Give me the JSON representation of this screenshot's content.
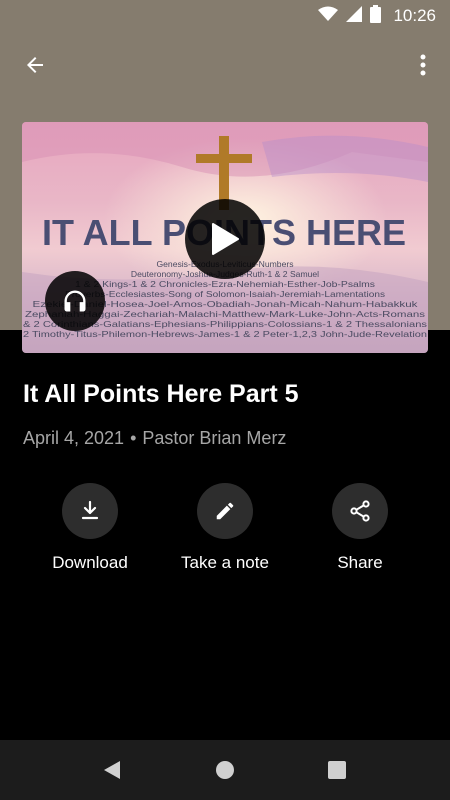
{
  "status_bar": {
    "time": "10:26",
    "icons": [
      "wifi-icon",
      "cell-signal-icon",
      "battery-icon"
    ]
  },
  "app_bar": {
    "back_icon": "arrow-back-icon",
    "menu_icon": "more-vert-icon"
  },
  "artwork": {
    "headline": "IT ALL POINTS HERE",
    "book_lines": [
      "Genesis-Exodus-Leviticus-Numbers",
      "Deuteronomy-Joshua-Judges-Ruth-1 & 2 Samuel",
      "1 & 2 Kings-1 & 2 Chronicles-Ezra-Nehemiah-Esther-Job-Psalms",
      "Proverbs-Ecclesiastes-Song of Solomon-Isaiah-Jeremiah-Lamentations",
      "Ezekiel-Daniel-Hosea-Joel-Amos-Obadiah-Jonah-Micah-Nahum-Habakkuk",
      "Zephaniah-Haggai-Zechariah-Malachi-Matthew-Mark-Luke-John-Acts-Romans",
      "& 2 Corinthians-Galatians-Ephesians-Philippians-Colossians-1 & 2 Thessalonians",
      "2 Timothy-Titus-Philemon-Hebrews-James-1 & 2 Peter-1,2,3 John-Jude-Revelation"
    ]
  },
  "sermon": {
    "title": "It All Points Here Part 5",
    "date": "April 4, 2021",
    "separator": "•",
    "speaker": "Pastor Brian Merz"
  },
  "actions": [
    {
      "label": "Download",
      "icon": "download-icon"
    },
    {
      "label": "Take a note",
      "icon": "pencil-icon"
    },
    {
      "label": "Share",
      "icon": "share-icon"
    }
  ],
  "nav": {
    "icons": [
      "back-triangle-icon",
      "home-circle-icon",
      "recents-square-icon"
    ]
  },
  "colors": {
    "header_bg": "#857c6e",
    "body_bg": "#000000",
    "action_circle": "#2d2d2d",
    "subtitle": "#a6a6a6"
  }
}
